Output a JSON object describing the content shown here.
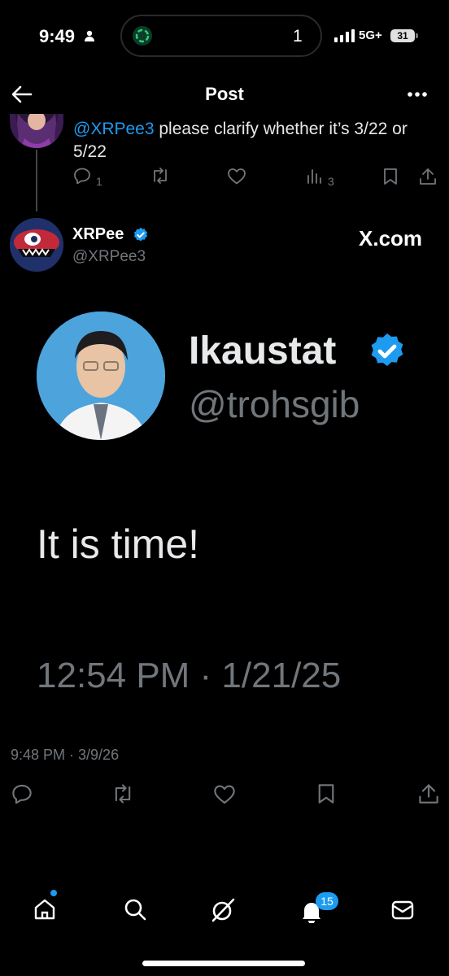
{
  "status_bar": {
    "time": "9:49",
    "island_count": "1",
    "network": "5G+",
    "battery": "31"
  },
  "header": {
    "title": "Post"
  },
  "reply": {
    "mention": "@XRPee3",
    "text": " please clarify whether it’s 3/22 or 5/22",
    "reply_count": "1",
    "view_count": "3"
  },
  "post": {
    "author_name": "XRPee",
    "author_handle": "@XRPee3",
    "source_label": "X.com",
    "timestamp": "9:48 PM · 3/9/26",
    "embedded": {
      "name": "Ikaustat",
      "handle": "@trohsgib",
      "text": "It is time!",
      "time": "12:54 PM · 1/21/25"
    }
  },
  "bottom_nav": {
    "notification_badge": "15"
  },
  "colors": {
    "accent": "#1d9bf0",
    "muted": "#71767b",
    "background": "#000000"
  },
  "icons": [
    "person-icon",
    "signal-icon",
    "back-arrow-icon",
    "more-icon",
    "reply-icon",
    "repost-icon",
    "like-icon",
    "views-icon",
    "bookmark-icon",
    "share-icon",
    "verified-icon",
    "home-icon",
    "search-icon",
    "grok-icon",
    "bell-icon",
    "mail-icon"
  ]
}
